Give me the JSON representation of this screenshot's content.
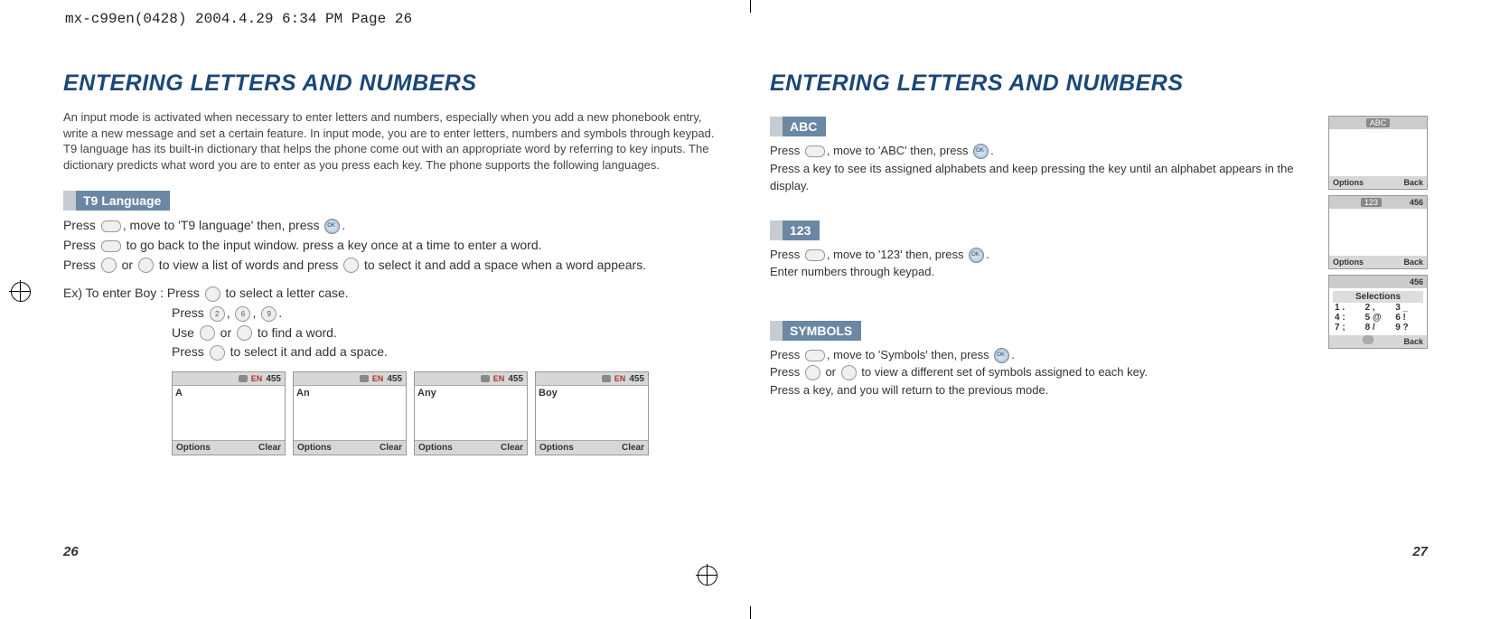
{
  "header": "mx-c99en(0428)  2004.4.29  6:34 PM  Page 26",
  "left": {
    "title": "ENTERING LETTERS AND NUMBERS",
    "intro": "An input mode is activated when necessary to enter letters and numbers, especially when you add a new phonebook entry, write a new message and set a certain feature. In input mode, you are to enter letters, numbers and symbols through keypad. T9 language has its built-in dictionary that helps the phone come out with an appropriate word by referring to key inputs. The dictionary predicts what word you are to enter as you press each key. The phone supports the following languages.",
    "section_label": "T9 Language",
    "line1a": "Press ",
    "line1b": ", move to 'T9 language' then, press ",
    "line1c": ".",
    "line2a": "Press ",
    "line2b": " to go back to the input window. press a key once at a time to enter a word.",
    "line3a": "Press ",
    "line3b": " or ",
    "line3c": " to view a list of words and press ",
    "line3d": " to select it and add a space when a word appears.",
    "ex_label": "Ex) To enter Boy : ",
    "ex1a": "Press ",
    "ex1b": " to select a letter case.",
    "ex2a": "Press ",
    "ex2b": ", ",
    "ex2c": ", ",
    "ex2d": ".",
    "ex3a": "Use ",
    "ex3b": " or ",
    "ex3c": " to find a word.",
    "ex4a": "Press ",
    "ex4b": " to select it and add a space.",
    "phones": [
      {
        "count": "455",
        "text": "A",
        "left": "Options",
        "right": "Clear"
      },
      {
        "count": "455",
        "text": "An",
        "left": "Options",
        "right": "Clear"
      },
      {
        "count": "455",
        "text": "Any",
        "left": "Options",
        "right": "Clear"
      },
      {
        "count": "455",
        "text": "Boy",
        "left": "Options",
        "right": "Clear"
      }
    ],
    "page_number": "26"
  },
  "right": {
    "title": "ENTERING LETTERS AND NUMBERS",
    "abc": {
      "label": "ABC",
      "line1a": "Press ",
      "line1b": ", move to 'ABC' then, press ",
      "line1c": ".",
      "line2": "Press a key to see its assigned alphabets and keep pressing the key until an alphabet appears in the display."
    },
    "n123": {
      "label": "123",
      "line1a": "Press ",
      "line1b": ", move to '123' then, press ",
      "line1c": ".",
      "line2": "Enter numbers through keypad."
    },
    "sym": {
      "label": "SYMBOLS",
      "line1a": "Press ",
      "line1b": ", move to 'Symbols' then, press ",
      "line1c": ".",
      "line2a": "Press ",
      "line2b": " or ",
      "line2c": " to view a different set of symbols assigned to each key.",
      "line3": "Press a key, and you will return to the previous mode."
    },
    "phones": {
      "abc": {
        "tag": "ABC",
        "count": "",
        "left": "Options",
        "right": "Back"
      },
      "num": {
        "tag": "123",
        "count": "456",
        "left": "Options",
        "right": "Back"
      },
      "symbols": {
        "count": "456",
        "title": "Selections",
        "r1": [
          "1 .",
          "2 ,",
          "3 _"
        ],
        "r2": [
          "4 :",
          "5 @",
          "6 !"
        ],
        "r3": [
          "7 ;",
          "8 /",
          "9 ?"
        ],
        "right": "Back"
      }
    },
    "page_number": "27",
    "en_label": "EN"
  }
}
